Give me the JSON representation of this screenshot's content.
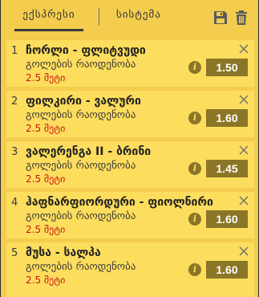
{
  "tabs": {
    "express": "ექსპრესი",
    "system": "სისტემა"
  },
  "header_icons": [
    "save-icon",
    "trash-icon"
  ],
  "colors": {
    "background": "#f4cd4e",
    "card": "#fddd5d",
    "odds_button": "#8b7526",
    "selection_text": "#cc1212"
  },
  "bets": [
    {
      "num": "1",
      "match": "ჩორლი - ფლიტვუდი",
      "market": "გოლების რაოდენობა",
      "selection": "2.5 მეტი",
      "odds": "1.50"
    },
    {
      "num": "2",
      "match": "ფილკირი - ვალური",
      "market": "გოლების რაოდენობა",
      "selection": "2.5 მეტი",
      "odds": "1.60"
    },
    {
      "num": "3",
      "match": "ვალერენგა II - ბრინი",
      "market": "გოლების რაოდენობა",
      "selection": "2.5 მეტი",
      "odds": "1.45"
    },
    {
      "num": "4",
      "match": "ჰაფნარფიორდური - ფიოლნირი",
      "market": "გოლების რაოდენობა",
      "selection": "2.5 მეტი",
      "odds": "1.60"
    },
    {
      "num": "5",
      "match": "მუსა - სალპა",
      "market": "გოლების რაოდენობა",
      "selection": "2.5 მეტი",
      "odds": "1.60"
    }
  ]
}
